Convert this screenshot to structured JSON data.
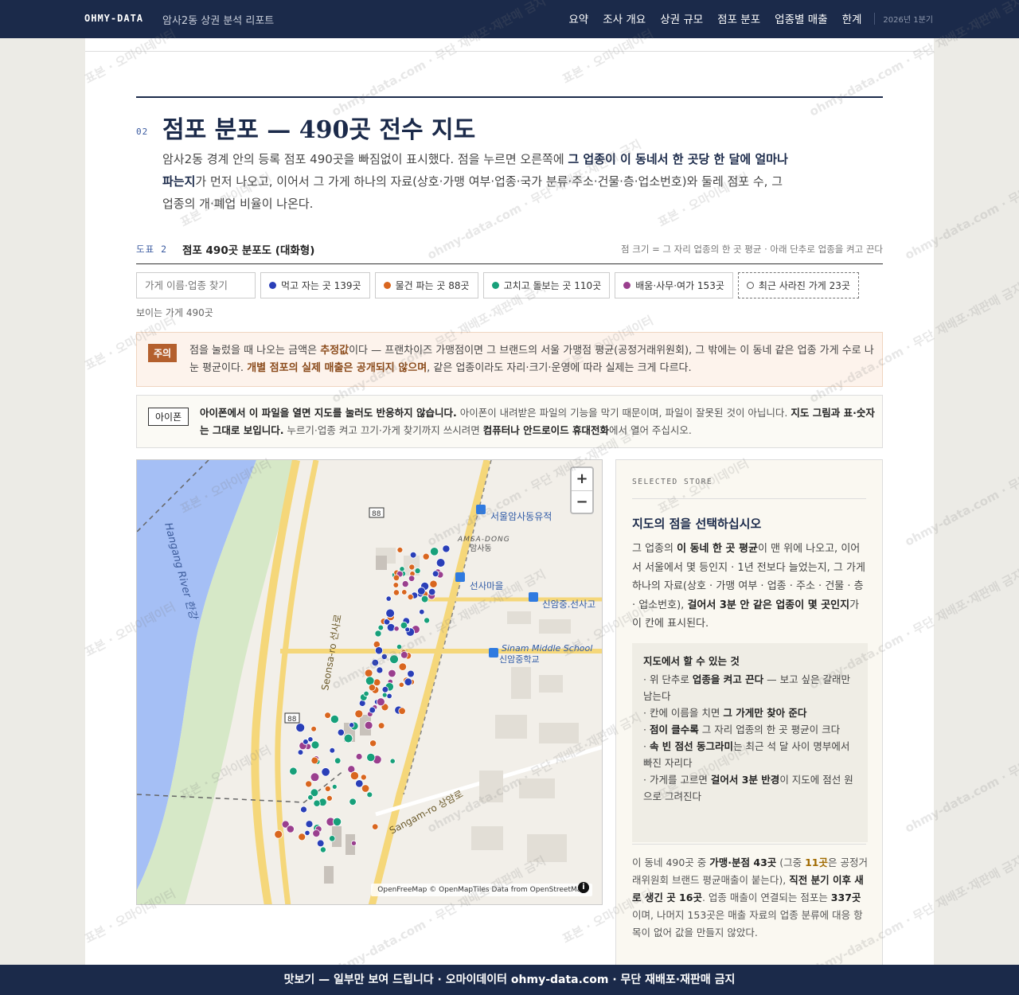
{
  "header": {
    "brand": "OHMY-DATA",
    "subtitle": "암사2동 상권 분석 리포트",
    "nav": [
      "요약",
      "조사 개요",
      "상권 규모",
      "점포 분포",
      "업종별 매출",
      "한계"
    ],
    "period": "2026년 1분기"
  },
  "section": {
    "number": "02",
    "title": "점포 분포 — 490곳 전수 지도",
    "lede": {
      "p1": "암사2동 경계 안의 등록 점포 490곳을 빠짐없이 표시했다. 점을 누르면 오른쪽에 ",
      "b1": "그 업종이 이 동네서 한 곳당 한 달에 얼마나 파는지",
      "p2": "가 먼저 나오고, 이어서 그 가게 하나의 자료(상호·가맹 여부·업종·국가 분류·주소·건물·층·업소번호)와 둘레 점포 수, 그 업종의 개·폐업 비율이 나온다."
    }
  },
  "figure": {
    "number": "도표 2",
    "title": "점포 490곳 분포도 (대화형)",
    "note": "점 크기 = 그 자리 업종의 한 곳 평균 · 아래 단추로 업종을 켜고 끈다"
  },
  "controls": {
    "search_placeholder": "가게 이름·업종 찾기",
    "chips": [
      {
        "label": "먹고 자는 곳 139곳",
        "color": "#2a3fb8"
      },
      {
        "label": "물건 파는 곳 88곳",
        "color": "#d9661f"
      },
      {
        "label": "고치고 돌보는 곳 110곳",
        "color": "#17a07a"
      },
      {
        "label": "배움·사무·여가 153곳",
        "color": "#9a3f8e"
      }
    ],
    "closed_chip": "최근 사라진 가게 23곳",
    "visible_count": "보이는 가게 490곳"
  },
  "caution": {
    "tag": "주의",
    "t1": "점을 눌렀을 때 나오는 금액은 ",
    "b1": "추정값",
    "t2": "이다 — 프랜차이즈 가맹점이면 그 브랜드의 서울 가맹점 평균(공정거래위원회), 그 밖에는 이 동네 같은 업종 가게 수로 나눈 평균이다. ",
    "b2": "개별 점포의 실제 매출은 공개되지 않으며",
    "t3": ", 같은 업종이라도 자리·크기·운영에 따라 실제는 크게 다르다."
  },
  "iphone": {
    "tag": "아이폰",
    "b1": "아이폰에서 이 파일을 열면 지도를 눌러도 반응하지 않습니다.",
    "t1": " 아이폰이 내려받은 파일의 기능을 막기 때문이며, 파일이 잘못된 것이 아닙니다. ",
    "b2": "지도 그림과 표·숫자는 그대로 보입니다.",
    "t2": " 누르기·업종 켜고 끄기·가게 찾기까지 쓰시려면 ",
    "b3": "컴퓨터나 안드로이드 휴대전화",
    "t3": "에서 열어 주십시오."
  },
  "map": {
    "labels": {
      "river": "Hangang River 한강",
      "road1": "Seonsa-ro 선사로",
      "road2": "Sangam-ro 상암로",
      "dong": "AMSA-DONG",
      "dong_ko": "암사동",
      "site": "서울암사동유적",
      "stop1": "선사마을",
      "stop2": "신암중.선사고",
      "school_en": "Sinam Middle School",
      "school_ko": "신암중학교",
      "route": "88"
    },
    "zoom_in": "+",
    "zoom_out": "−",
    "attribution": "OpenFreeMap © OpenMapTiles Data from OpenStreetMap",
    "info": "i"
  },
  "panel": {
    "kicker": "SELECTED STORE",
    "heading": "지도의 점을 선택하십시오",
    "d1": "그 업종의 ",
    "db1": "이 동네 한 곳 평균",
    "d2": "이 맨 위에 나오고, 이어서 서울에서 몇 등인지 · 1년 전보다 늘었는지, 그 가게 하나의 자료(상호 · 가맹 여부 · 업종 · 주소 · 건물 · 층 · 업소번호), ",
    "db2": "걸어서 3분 안 같은 업종이 몇 곳인지",
    "d3": "가 이 칸에 표시된다.",
    "howto_title": "지도에서 할 수 있는 것",
    "howto": [
      {
        "pre": "· 위 단추로 ",
        "b": "업종을 켜고 끈다",
        "post": " — 보고 싶은 갈래만 남는다"
      },
      {
        "pre": "· 칸에 이름을 치면 ",
        "b": "그 가게만 찾아 준다",
        "post": ""
      },
      {
        "pre": "· ",
        "b": "점이 클수록",
        "post": " 그 자리 업종의 한 곳 평균이 크다"
      },
      {
        "pre": "· ",
        "b": "속 빈 점선 동그라미",
        "post": "는 최근 석 달 사이 명부에서 빠진 자리다"
      },
      {
        "pre": "· 가게를 고르면 ",
        "b": "걸어서 3분 반경",
        "post": "이 지도에 점선 원으로 그려진다"
      }
    ],
    "stat": {
      "t1": "이 동네 490곳 중 ",
      "b1": "가맹·분점 43곳",
      "t2": " (그중 ",
      "b2": "11곳",
      "t3": "은 공정거래위원회 브랜드 평균매출이 붙는다), ",
      "b3": "직전 분기 이후 새로 생긴 곳 16곳",
      "t4": ". 업종 매출이 연결되는 점포는 ",
      "b4": "337곳",
      "t5": "이며, 나머지 153곳은 매출 자료의 업종 분류에 대응 항목이 없어 값을 만들지 않았다."
    }
  },
  "footer": {
    "text": "맛보기 — 일부만 보여 드립니다 · 오마이데이터 ohmy-data.com · 무단 재배포·재판매 금지"
  },
  "watermark": {
    "a": "표본 · 오마이데이터",
    "b": "ohmy-data.com · 무단 재배포·재판매 금지"
  }
}
